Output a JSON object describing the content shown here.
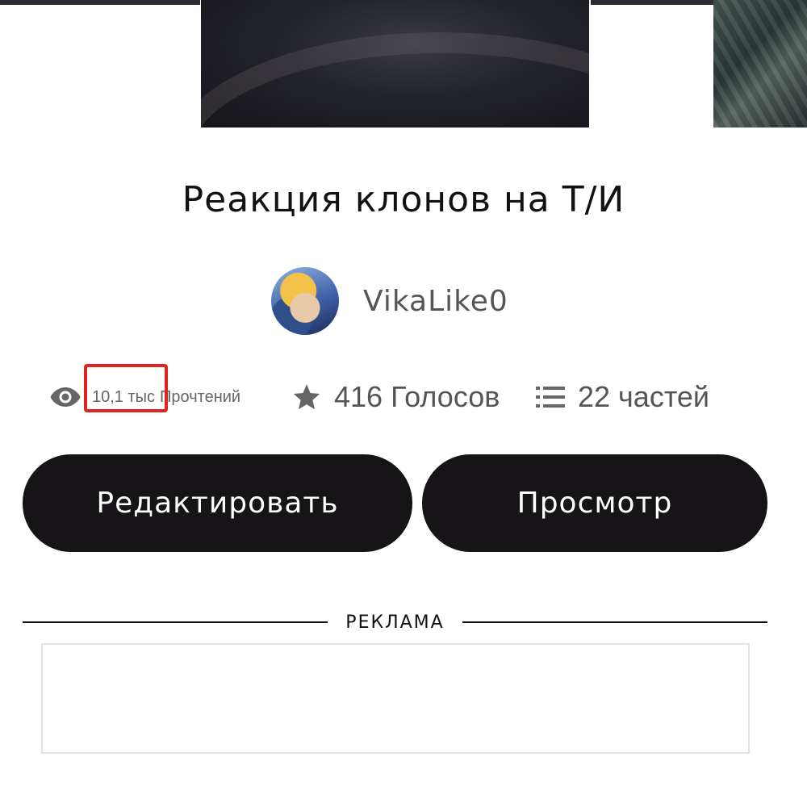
{
  "story": {
    "title": "Реакция клонов на Т/И",
    "author": "VikaLike0"
  },
  "stats": {
    "reads_count": "10,1 тыс",
    "reads_label": "Прочтений",
    "votes": "416 Голосов",
    "parts": "22 частей"
  },
  "actions": {
    "edit_label": "Редактировать",
    "view_label": "Просмотр"
  },
  "ad": {
    "label": "РЕКЛАМА"
  },
  "icons": {
    "reads": "eye-icon",
    "votes": "star-icon",
    "parts": "list-icon"
  },
  "colors": {
    "button_bg": "#161416",
    "button_text": "#ffffff",
    "highlight": "#e0231c",
    "stat_text": "#666666"
  }
}
